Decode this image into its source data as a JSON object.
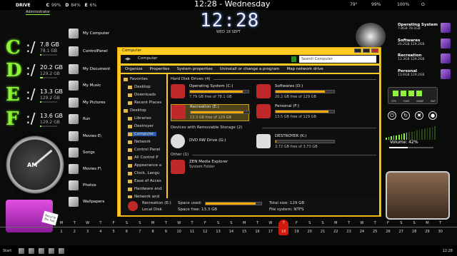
{
  "topbar": {
    "drive": "DRIVE",
    "c": "C",
    "c_val": "99%",
    "d": "D",
    "d_val": "84%",
    "e": "E",
    "e_val": "6%",
    "time": "12:28 - Wednesday",
    "temp": "79°",
    "battery": "99%",
    "wifi": "100%"
  },
  "admin": "Administrator",
  "clock": {
    "time": "12:28",
    "date": "WED 18 SEPT"
  },
  "left_drives": [
    {
      "letter": "C",
      "cap": "7.8 GB",
      "free": "78.1 GB",
      "fill": 0.1
    },
    {
      "letter": "D",
      "cap": "20.2 GB",
      "free": "129.2 GB",
      "fill": 0.16
    },
    {
      "letter": "E",
      "cap": "13.3 GB",
      "free": "129.2 GB",
      "fill": 0.1
    },
    {
      "letter": "F",
      "cap": "13.6 GB",
      "free": "129.2 GB",
      "fill": 0.1
    }
  ],
  "shortcuts": [
    "My Computer",
    "ControlPanel",
    "My Document",
    "My Music",
    "My Pictures",
    "Run",
    "Movies E\\",
    "Songs",
    "Movies F\\",
    "Photos",
    "Wallpapers"
  ],
  "gauge_label": "AM",
  "basket_tag": "Recycle Bin Full",
  "right_drives": [
    {
      "name": "Operating System",
      "val": "7.8GB 78.1GB"
    },
    {
      "name": "Softwares",
      "val": "20.2GB 129.2GB"
    },
    {
      "name": "Recreation",
      "val": "13.3GB 129.2GB"
    },
    {
      "name": "Personal",
      "val": "13.6GB 129.2GB"
    }
  ],
  "sysmon_labels": [
    "CPU",
    "RAM",
    "SWAP",
    "BAT"
  ],
  "volume": {
    "label": "Volume: 42%",
    "level": 0.42
  },
  "explorer": {
    "title": "Computer",
    "path": "Computer",
    "search_placeholder": "Search Computer",
    "toolbar": [
      "Organize",
      "Properties",
      "System properties",
      "Uninstall or change a program",
      "Map network drive"
    ],
    "nav": [
      {
        "label": "Favorites",
        "head": true
      },
      {
        "label": "Desktop"
      },
      {
        "label": "Downloads"
      },
      {
        "label": "Recent Places"
      },
      {
        "label": "Desktop",
        "head": true
      },
      {
        "label": "Libraries"
      },
      {
        "label": "Destroyer"
      },
      {
        "label": "Computer",
        "sel": true
      },
      {
        "label": "Network"
      },
      {
        "label": "Control Panel"
      },
      {
        "label": "All Control P"
      },
      {
        "label": "Appearance a"
      },
      {
        "label": "Clock, Langu"
      },
      {
        "label": "Ease of Acces"
      },
      {
        "label": "Hardware and"
      },
      {
        "label": "Network and"
      }
    ],
    "section_hdd": "Hard Disk Drives (4)",
    "section_removable": "Devices with Removable Storage (2)",
    "section_other": "Other (1)",
    "drives": [
      {
        "name": "Operating System (C:)",
        "free": "7.79 GB free of 78.1 GB",
        "fill": 0.9
      },
      {
        "name": "Softwares (D:)",
        "free": "20.2 GB free of 129 GB",
        "fill": 0.84
      },
      {
        "name": "Recreation (E:)",
        "free": "13.3 GB free of 129 GB",
        "fill": 0.9,
        "sel": true
      },
      {
        "name": "Personal (F:)",
        "free": "13.5 GB free of 129 GB",
        "fill": 0.9
      }
    ],
    "removable": [
      {
        "name": "DVD RW Drive (G:)"
      },
      {
        "name": "DESTROYER (K:)",
        "free": "3.72 GB free of 3.73 GB",
        "fill": 0.01
      }
    ],
    "other": [
      {
        "name": "ZEN Media Explorer",
        "sub": "System Folder"
      }
    ],
    "details": {
      "name": "Recreation (E:)",
      "type": "Local Disk",
      "used_label": "Space used:",
      "free_label": "Space free: 13.3 GB",
      "total": "Total size: 129 GB",
      "fs": "File system: NTFS",
      "used_fill": 0.9
    }
  },
  "calendar": {
    "weekdays": [
      "M",
      "T",
      "W",
      "T",
      "F",
      "S",
      "S",
      "M",
      "T",
      "W",
      "T",
      "F",
      "S",
      "S",
      "M",
      "T",
      "W",
      "T",
      "F",
      "S",
      "S",
      "M",
      "T",
      "W",
      "T",
      "F",
      "S",
      "S",
      "M",
      "T"
    ],
    "days": [
      "1",
      "2",
      "3",
      "4",
      "5",
      "6",
      "7",
      "8",
      "9",
      "10",
      "11",
      "12",
      "13",
      "14",
      "15",
      "16",
      "17",
      "18",
      "19",
      "20",
      "21",
      "22",
      "23",
      "24",
      "25",
      "26",
      "27",
      "28",
      "29",
      "30"
    ],
    "today_index": 17
  },
  "taskbar": {
    "start": "Start",
    "time": "12:28"
  }
}
